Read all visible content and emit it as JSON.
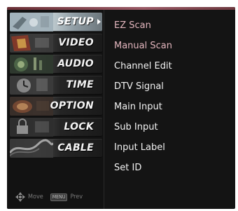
{
  "menu": {
    "items": [
      {
        "label": "SETUP",
        "icon": "setup-icon",
        "selected": true
      },
      {
        "label": "VIDEO",
        "icon": "video-icon",
        "selected": false
      },
      {
        "label": "AUDIO",
        "icon": "audio-icon",
        "selected": false
      },
      {
        "label": "TIME",
        "icon": "time-icon",
        "selected": false
      },
      {
        "label": "OPTION",
        "icon": "option-icon",
        "selected": false
      },
      {
        "label": "LOCK",
        "icon": "lock-icon",
        "selected": false
      },
      {
        "label": "CABLE",
        "icon": "cable-icon",
        "selected": false
      }
    ]
  },
  "submenu": {
    "items": [
      {
        "label": "EZ Scan"
      },
      {
        "label": "Manual Scan"
      },
      {
        "label": "Channel Edit"
      },
      {
        "label": "DTV Signal"
      },
      {
        "label": "Main Input"
      },
      {
        "label": "Sub Input"
      },
      {
        "label": "Input Label"
      },
      {
        "label": "Set ID"
      }
    ]
  },
  "nav_hints": {
    "move_label": "Move",
    "prev_key": "MENU",
    "prev_label": "Prev"
  },
  "colors": {
    "panel_bg": "#141414",
    "submenu_accent": "#e3b6be",
    "submenu_text": "#f2f2f2",
    "selected_item_bg": "#c8d4da"
  }
}
